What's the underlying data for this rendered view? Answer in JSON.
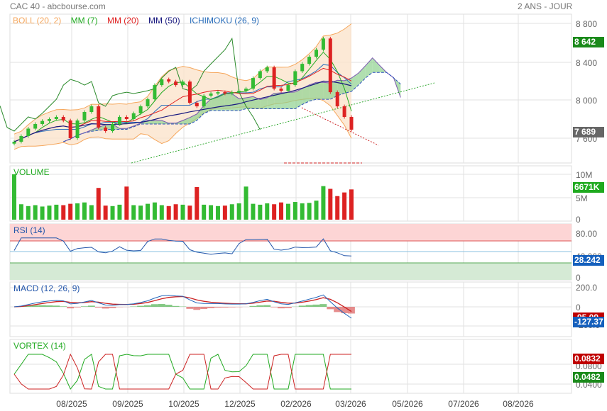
{
  "header": {
    "title": "CAC 40 - abcbourse.com",
    "period": "2 ANS - JOUR"
  },
  "legend": [
    {
      "label": "BOLL (20, 2)",
      "color": "#f5a65b"
    },
    {
      "label": "MM (7)",
      "color": "#22aa22"
    },
    {
      "label": "MM (20)",
      "color": "#e02020"
    },
    {
      "label": "MM (50)",
      "color": "#1a1a80"
    },
    {
      "label": "ICHIMOKU (26, 9)",
      "color": "#2a6ebb"
    }
  ],
  "panels": {
    "volume": {
      "label": "VOLUME",
      "color": "#22aa22"
    },
    "rsi": {
      "label": "RSI (14)",
      "color": "#2255aa"
    },
    "macd": {
      "label": "MACD (12, 26, 9)",
      "color": "#2255aa"
    },
    "vortex": {
      "label": "VORTEX (14)",
      "color": "#22aa22"
    }
  },
  "y_axes": {
    "price": [
      "8 800",
      "8 400",
      "8 000",
      "7 600"
    ],
    "volume": [
      "10M",
      "5M",
      "0"
    ],
    "rsi": [
      "0",
      "80.00",
      "40.000",
      "0"
    ],
    "macd": [
      "200.0",
      "0",
      "-200.0"
    ],
    "vortex": [
      "0.0800",
      "0.0400"
    ]
  },
  "badges": {
    "price_high": {
      "text": "8 642",
      "color": "#1a8a1a"
    },
    "price_last": {
      "text": "7 689",
      "color": "#666666"
    },
    "volume_last": {
      "text": "6671K",
      "color": "#1faa1f"
    },
    "rsi_last": {
      "text": "28.242",
      "color": "#1560bd"
    },
    "macd_signal": {
      "text": "-95.09",
      "color": "#c00000"
    },
    "macd_last": {
      "text": "-127.37",
      "color": "#1560bd"
    },
    "vortex_minus": {
      "text": "0.0832",
      "color": "#c00000"
    },
    "vortex_plus": {
      "text": "0.0482",
      "color": "#1a8a1a"
    }
  },
  "x_ticks": [
    "08/2025",
    "09/2025",
    "10/2025",
    "12/2025",
    "02/2026",
    "03/2026",
    "05/2026",
    "07/2026",
    "08/2026"
  ],
  "chart_data": {
    "type": "candlestick",
    "ylim": [
      7450,
      8900
    ],
    "closes": [
      7563,
      7622,
      7700,
      7748,
      7780,
      7800,
      7822,
      7785,
      7600,
      7785,
      7874,
      7933,
      7711,
      7674,
      7748,
      7822,
      7800,
      7860,
      7933,
      8007,
      8155,
      8215,
      8192,
      8155,
      8192,
      7970,
      7933,
      8044,
      8067,
      8081,
      8067,
      8081,
      8096,
      8118,
      8229,
      8300,
      8340,
      8118,
      8096,
      8155,
      8300,
      8377,
      8451,
      8525,
      8642,
      8081,
      7933,
      7822,
      7689
    ],
    "volume_millions": [
      10,
      3.4,
      3,
      3.2,
      2.9,
      3.1,
      3.3,
      3.2,
      3.5,
      3.6,
      3.8,
      3.2,
      7,
      3.1,
      3,
      3.3,
      7.3,
      3.2,
      3.1,
      3.5,
      3.8,
      3.2,
      3,
      3.4,
      3.3,
      3.1,
      7.2,
      3.3,
      3.2,
      3,
      3.1,
      3.4,
      3.6,
      7.3,
      3.5,
      3.3,
      3.6,
      3.4,
      3.8,
      3.5,
      3.9,
      3.6,
      3.7,
      4.2,
      7.4,
      6.8,
      5.2,
      6,
      6.67
    ],
    "ichimoku_ahead_points": 7
  },
  "grid": true
}
